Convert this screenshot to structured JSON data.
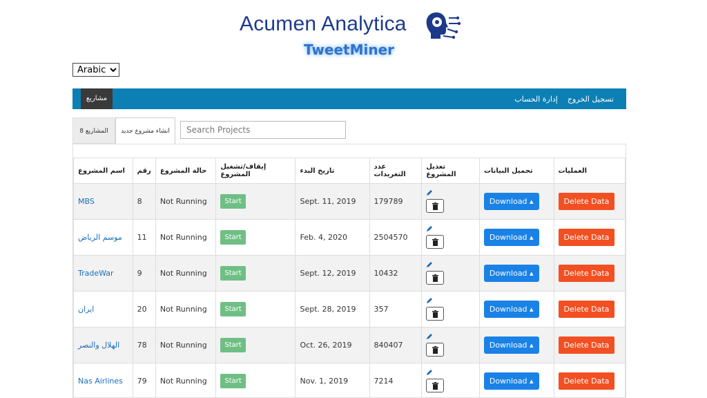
{
  "brand": {
    "title": "Acumen Analytica",
    "subtitle": "TweetMiner"
  },
  "language": {
    "selected": "Arabic"
  },
  "nav": {
    "active": "مشاريع",
    "account": "إدارة الحساب",
    "logout": "تسجيل الخروج"
  },
  "tabs": {
    "projects": "8 المشاريع",
    "new_project": "انشاء مشروع جديد"
  },
  "search": {
    "placeholder": "Search Projects"
  },
  "table": {
    "headers": [
      "اسم المشروع",
      "رقم",
      "حالة المشروع",
      "إيقاف/تشغيل المشروع",
      "تاريخ البدء",
      "عدد التغريدات",
      "تعديل المشروع",
      "تحميل البيانات",
      "العمليات"
    ],
    "rows": [
      {
        "name": "MBS",
        "id": "8",
        "status": "Not Running",
        "action": "Start",
        "start_date": "Sept. 11, 2019",
        "tweets": "179789",
        "download": "Download",
        "delete": "Delete Data"
      },
      {
        "name": "موسم الرياض",
        "id": "11",
        "status": "Not Running",
        "action": "Start",
        "start_date": "Feb. 4, 2020",
        "tweets": "2504570",
        "download": "Download",
        "delete": "Delete Data"
      },
      {
        "name": "TradeWar",
        "id": "9",
        "status": "Not Running",
        "action": "Start",
        "start_date": "Sept. 12, 2019",
        "tweets": "10432",
        "download": "Download",
        "delete": "Delete Data"
      },
      {
        "name": "ايران",
        "id": "20",
        "status": "Not Running",
        "action": "Start",
        "start_date": "Sept. 28, 2019",
        "tweets": "357",
        "download": "Download",
        "delete": "Delete Data"
      },
      {
        "name": "الهلال والنصر",
        "id": "78",
        "status": "Not Running",
        "action": "Start",
        "start_date": "Oct. 26, 2019",
        "tweets": "840407",
        "download": "Download",
        "delete": "Delete Data"
      },
      {
        "name": "Nas Airlines",
        "id": "79",
        "status": "Not Running",
        "action": "Start",
        "start_date": "Nov. 1, 2019",
        "tweets": "7214",
        "download": "Download",
        "delete": "Delete Data"
      }
    ]
  },
  "colors": {
    "nav": "#0c7fb4",
    "start": "#6fbf85",
    "download": "#1a82e6",
    "delete": "#f25022",
    "brand": "#1d3a8a"
  }
}
